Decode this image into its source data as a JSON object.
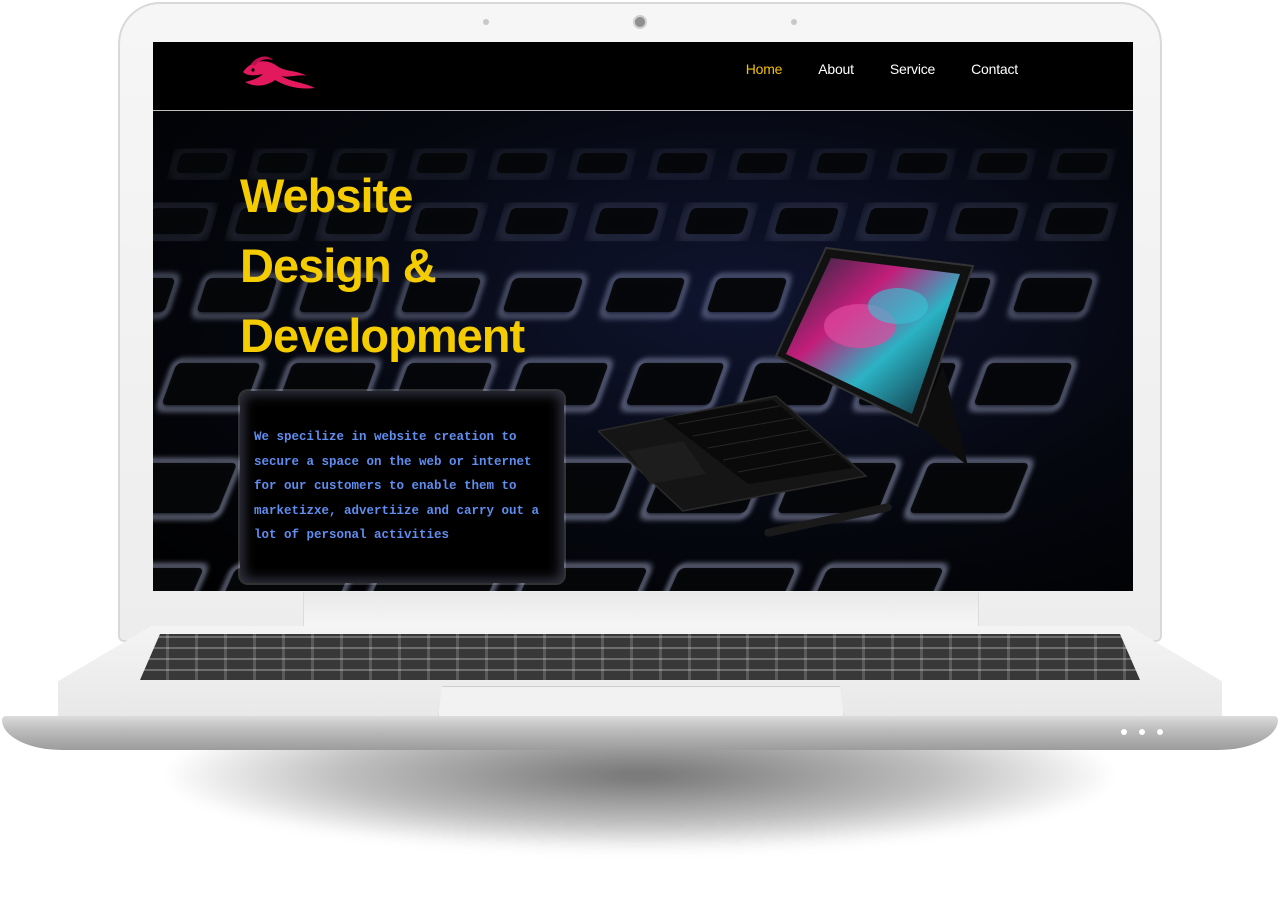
{
  "nav": {
    "logo": "logo",
    "items": [
      {
        "label": "Home",
        "active": true
      },
      {
        "label": "About",
        "active": false
      },
      {
        "label": "Service",
        "active": false
      },
      {
        "label": "Contact",
        "active": false
      }
    ],
    "active_color": "#f2c200"
  },
  "hero": {
    "headline_lines": [
      "Website",
      "Design &",
      "Development"
    ],
    "headline_color": "#f4cc00",
    "description": "We specilize in website creation to secure a space on the web or internet for our customers to enable them to marketizxe, advertiize and carry out a lot of personal activities",
    "description_color": "#5f8df0"
  }
}
